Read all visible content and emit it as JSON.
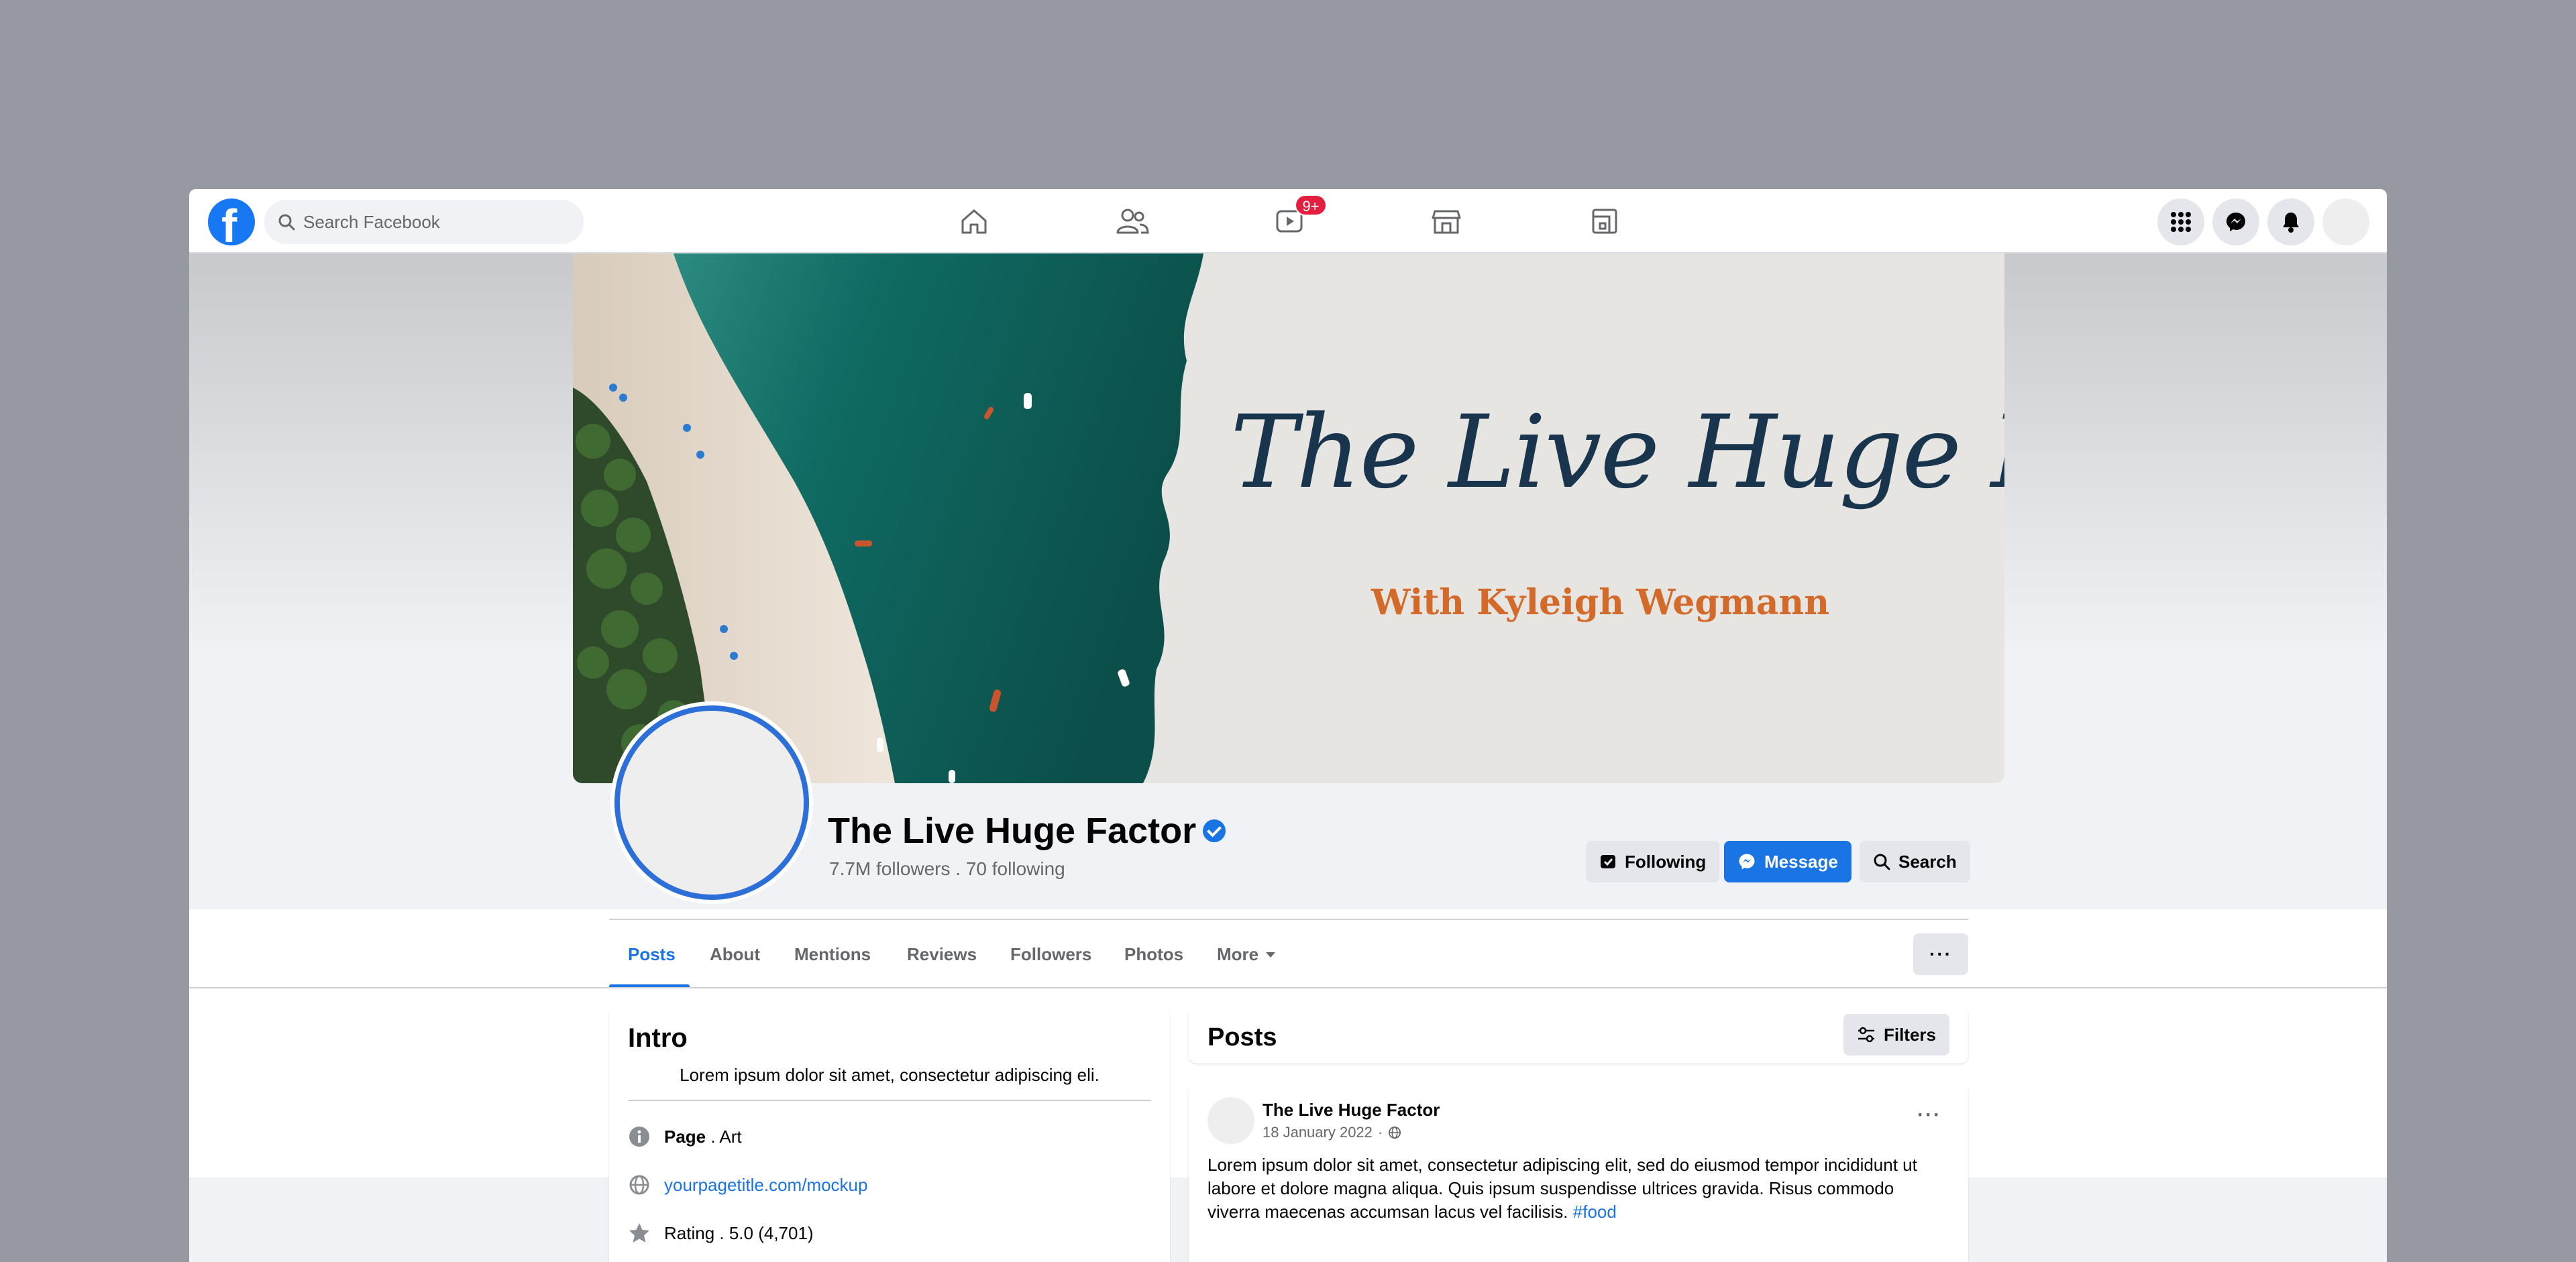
{
  "topbar": {
    "logo": "facebook-logo",
    "search_placeholder": "Search Facebook",
    "nav_icons": [
      "home-icon",
      "friends-icon",
      "watch-icon",
      "marketplace-icon",
      "gaming-icon"
    ],
    "watch_badge": "9+",
    "right_icons": [
      "menu-grid-icon",
      "messenger-icon",
      "notifications-icon",
      "account-avatar"
    ]
  },
  "cover": {
    "title": "The Live Huge Factor",
    "subtitle": "With Kyleigh Wegmann"
  },
  "profile": {
    "name": "The Live Huge Factor",
    "verified": true,
    "stats": "7.7M followers . 70 following",
    "buttons": {
      "following": "Following",
      "message": "Message",
      "search": "Search"
    }
  },
  "tabs": [
    "Posts",
    "About",
    "Mentions",
    "Reviews",
    "Followers",
    "Photos",
    "More"
  ],
  "active_tab": "Posts",
  "more_options": "···",
  "intro": {
    "title": "Intro",
    "bio": "Lorem ipsum dolor sit amet, consectetur adipiscing eli.",
    "page_label": "Page",
    "page_category": " . Art",
    "website": "yourpagetitle.com/mockup",
    "rating": "Rating . 5.0 (4,701)"
  },
  "posts_header": {
    "title": "Posts",
    "filters_label": "Filters"
  },
  "post": {
    "author": "The Live Huge Factor",
    "date": "18 January 2022",
    "date_sep": "·",
    "text": "Lorem ipsum dolor sit amet, consectetur adipiscing elit, sed do eiusmod tempor incididunt ut labore et dolore magna aliqua. Quis ipsum suspendisse ultrices gravida. Risus commodo viverra maecenas accumsan lacus vel facilisis.",
    "hashtag": "#food",
    "menu": "···"
  },
  "colors": {
    "brand_blue": "#1b74e4",
    "badge_red": "#e41e3f",
    "cover_navy": "#19344d",
    "cover_orange": "#d46a2a"
  }
}
